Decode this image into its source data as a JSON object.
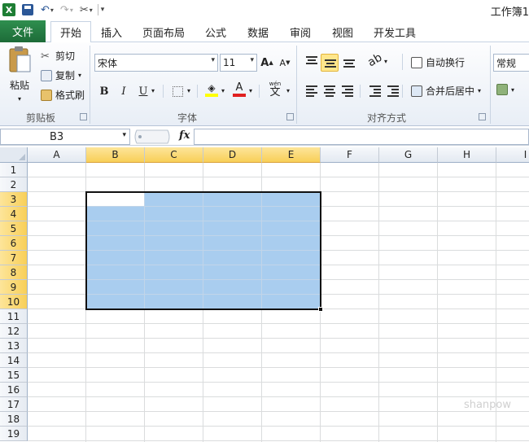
{
  "titlebar": {
    "title": "工作簿1",
    "icons": [
      "excel-logo-icon",
      "save-icon",
      "undo-icon",
      "redo-icon",
      "tools-icon",
      "customize-qat-icon"
    ]
  },
  "tabs": {
    "file": "文件",
    "items": [
      "开始",
      "插入",
      "页面布局",
      "公式",
      "数据",
      "审阅",
      "视图",
      "开发工具"
    ],
    "active_index": 0
  },
  "ribbon": {
    "clipboard": {
      "paste": "粘贴",
      "cut": "剪切",
      "copy": "复制",
      "format_painter": "格式刷",
      "label": "剪贴板"
    },
    "font": {
      "font_name": "宋体",
      "font_size": "11",
      "bold": "B",
      "italic": "I",
      "underline": "U",
      "grow": "A",
      "shrink": "A",
      "font_color": "A",
      "wen": "文",
      "label": "字体"
    },
    "alignment": {
      "wrap_text": "自动换行",
      "merge_center": "合并后居中",
      "label": "对齐方式"
    },
    "number": {
      "format": "常规"
    }
  },
  "formula_bar": {
    "namebox": "B3",
    "fx": "fx",
    "content": ""
  },
  "sheet": {
    "columns": [
      "A",
      "B",
      "C",
      "D",
      "E",
      "F",
      "G",
      "H",
      "I"
    ],
    "selected_columns": [
      "B",
      "C",
      "D",
      "E"
    ],
    "rows": [
      "1",
      "2",
      "3",
      "4",
      "5",
      "6",
      "7",
      "8",
      "9",
      "10",
      "11",
      "12",
      "13",
      "14",
      "15",
      "16",
      "17",
      "18",
      "19"
    ],
    "selected_rows": [
      "3",
      "4",
      "5",
      "6",
      "7",
      "8",
      "9",
      "10"
    ],
    "selection": "B3:E10",
    "active_cell": "B3"
  },
  "colors": {
    "file_tab": "#217346",
    "selection_fill": "#a9cdef",
    "header_selected": "#f8cf58"
  }
}
